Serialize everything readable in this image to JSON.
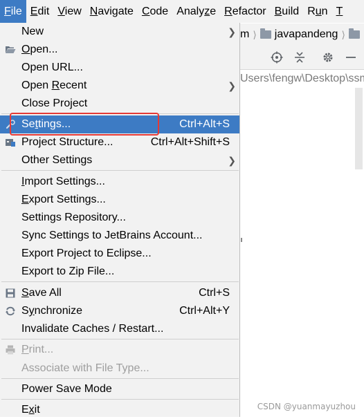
{
  "menubar": [
    {
      "pre": "",
      "mn": "F",
      "post": "ile"
    },
    {
      "pre": "",
      "mn": "E",
      "post": "dit"
    },
    {
      "pre": "",
      "mn": "V",
      "post": "iew"
    },
    {
      "pre": "",
      "mn": "N",
      "post": "avigate"
    },
    {
      "pre": "",
      "mn": "C",
      "post": "ode"
    },
    {
      "pre": "Analy",
      "mn": "z",
      "post": "e"
    },
    {
      "pre": "",
      "mn": "R",
      "post": "efactor"
    },
    {
      "pre": "",
      "mn": "B",
      "post": "uild"
    },
    {
      "pre": "R",
      "mn": "u",
      "post": "n"
    },
    {
      "pre": "",
      "mn": "T",
      "post": ""
    }
  ],
  "breadcrumb": {
    "first": "m",
    "project": "javapandeng"
  },
  "path_text": "Users\\fengw\\Desktop\\ssm",
  "menu": {
    "new": {
      "label": "New"
    },
    "open": {
      "pre": "",
      "mn": "O",
      "post": "pen..."
    },
    "open_url": {
      "label": "Open URL..."
    },
    "open_recent": {
      "pre": "Open ",
      "mn": "R",
      "post": "ecent"
    },
    "close_project": {
      "pre": "Close Pro",
      "mn": "j",
      "post": "ect"
    },
    "settings": {
      "pre": "Se",
      "mn": "t",
      "post": "tings...",
      "shortcut": "Ctrl+Alt+S"
    },
    "project_structure": {
      "label": "Project Structure...",
      "shortcut": "Ctrl+Alt+Shift+S"
    },
    "other_settings": {
      "label": "Other Settings"
    },
    "import_settings": {
      "pre": "",
      "mn": "I",
      "post": "mport Settings..."
    },
    "export_settings": {
      "pre": "",
      "mn": "E",
      "post": "xport Settings..."
    },
    "settings_repository": {
      "label": "Settings Repository..."
    },
    "sync_settings": {
      "label": "Sync Settings to JetBrains Account..."
    },
    "export_eclipse": {
      "label": "Export Project to Eclipse..."
    },
    "export_zip": {
      "label": "Export to Zip File..."
    },
    "save_all": {
      "pre": "",
      "mn": "S",
      "post": "ave All",
      "shortcut": "Ctrl+S"
    },
    "synchronize": {
      "pre": "S",
      "mn": "y",
      "post": "nchronize",
      "shortcut": "Ctrl+Alt+Y"
    },
    "invalidate_caches": {
      "label": "Invalidate Caches / Restart..."
    },
    "print": {
      "pre": "",
      "mn": "P",
      "post": "rint..."
    },
    "associate": {
      "label": "Associate with File Type..."
    },
    "power_save": {
      "label": "Power Save Mode"
    },
    "exit": {
      "pre": "E",
      "mn": "x",
      "post": "it"
    }
  },
  "watermark": "CSDN @yuanmayuzhou",
  "colors": {
    "highlight": "#3d7bc4",
    "menu_bg": "#f2f2f2",
    "annotation_box": "#e53935"
  }
}
